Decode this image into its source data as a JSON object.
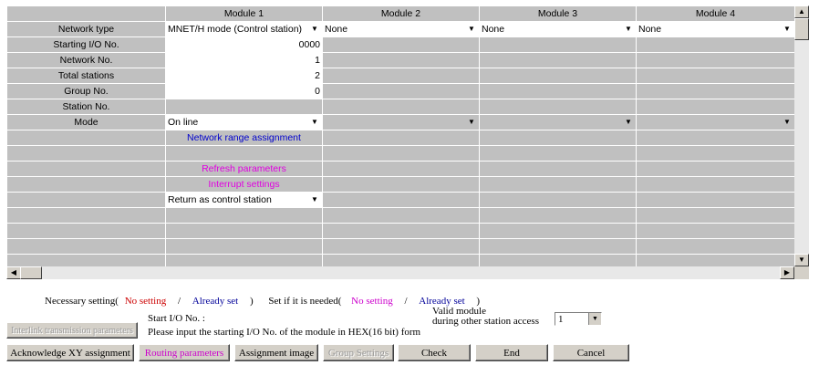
{
  "grid": {
    "columns": [
      "Module 1",
      "Module 2",
      "Module 3",
      "Module 4"
    ],
    "rows": [
      {
        "label": "Network type",
        "cells": [
          {
            "type": "select",
            "value": "MNET/H mode (Control station)"
          },
          {
            "type": "select",
            "value": "None"
          },
          {
            "type": "select",
            "value": "None"
          },
          {
            "type": "select",
            "value": "None"
          }
        ]
      },
      {
        "label": "Starting I/O No.",
        "cells": [
          {
            "type": "input",
            "value": "0000"
          },
          {
            "type": "blank"
          },
          {
            "type": "blank"
          },
          {
            "type": "blank"
          }
        ]
      },
      {
        "label": "Network No.",
        "cells": [
          {
            "type": "input",
            "value": "1"
          },
          {
            "type": "blank"
          },
          {
            "type": "blank"
          },
          {
            "type": "blank"
          }
        ]
      },
      {
        "label": "Total stations",
        "cells": [
          {
            "type": "input",
            "value": "2"
          },
          {
            "type": "blank"
          },
          {
            "type": "blank"
          },
          {
            "type": "blank"
          }
        ]
      },
      {
        "label": "Group No.",
        "cells": [
          {
            "type": "input",
            "value": "0"
          },
          {
            "type": "blank"
          },
          {
            "type": "blank"
          },
          {
            "type": "blank"
          }
        ]
      },
      {
        "label": "Station No.",
        "cells": [
          {
            "type": "blank"
          },
          {
            "type": "blank"
          },
          {
            "type": "blank"
          },
          {
            "type": "blank"
          }
        ]
      },
      {
        "label": "Mode",
        "cells": [
          {
            "type": "select",
            "value": "On line"
          },
          {
            "type": "select",
            "value": ""
          },
          {
            "type": "select",
            "value": ""
          },
          {
            "type": "select",
            "value": ""
          }
        ]
      },
      {
        "label": "",
        "cells": [
          {
            "type": "link",
            "value": "Network range assignment"
          },
          {
            "type": "blank"
          },
          {
            "type": "blank"
          },
          {
            "type": "blank"
          }
        ]
      },
      {
        "label": "",
        "cells": [
          {
            "type": "blank"
          },
          {
            "type": "blank"
          },
          {
            "type": "blank"
          },
          {
            "type": "blank"
          }
        ]
      },
      {
        "label": "",
        "cells": [
          {
            "type": "linkm",
            "value": "Refresh parameters"
          },
          {
            "type": "blank"
          },
          {
            "type": "blank"
          },
          {
            "type": "blank"
          }
        ]
      },
      {
        "label": "",
        "cells": [
          {
            "type": "linkm",
            "value": "Interrupt settings"
          },
          {
            "type": "blank"
          },
          {
            "type": "blank"
          },
          {
            "type": "blank"
          }
        ]
      },
      {
        "label": "",
        "cells": [
          {
            "type": "select",
            "value": "Return as control station"
          },
          {
            "type": "blank"
          },
          {
            "type": "blank"
          },
          {
            "type": "blank"
          }
        ]
      },
      {
        "label": "",
        "cells": [
          {
            "type": "blank"
          },
          {
            "type": "blank"
          },
          {
            "type": "blank"
          },
          {
            "type": "blank"
          }
        ]
      },
      {
        "label": "",
        "cells": [
          {
            "type": "blank"
          },
          {
            "type": "blank"
          },
          {
            "type": "blank"
          },
          {
            "type": "blank"
          }
        ]
      },
      {
        "label": "",
        "cells": [
          {
            "type": "blank"
          },
          {
            "type": "blank"
          },
          {
            "type": "blank"
          },
          {
            "type": "blank"
          }
        ]
      },
      {
        "label": "",
        "cells": [
          {
            "type": "blank"
          },
          {
            "type": "blank"
          },
          {
            "type": "blank"
          },
          {
            "type": "blank"
          }
        ]
      }
    ]
  },
  "scroll": {
    "up_icon": "up-arrow-icon",
    "down_icon": "down-arrow-icon",
    "left_icon": "left-arrow-icon",
    "right_icon": "right-arrow-icon"
  },
  "legend": {
    "necessary_prefix": "Necessary setting(",
    "no_setting": "No setting",
    "slash": "/",
    "already_set": "Already set",
    "close": ")",
    "if_needed_prefix": "Set if it is needed(",
    "no_setting2": "No setting",
    "already_set2": "Already set",
    "close2": ")"
  },
  "hint": {
    "start_io_label": "Start I/O No. :",
    "instruction": "Please input the starting I/O No. of the module in HEX(16 bit) form"
  },
  "valid_module": {
    "label_line1": "Valid module",
    "label_line2": "during other station access",
    "value": "1"
  },
  "buttons": {
    "interlink": "Interlink transmission parameters",
    "acknowledge": "Acknowledge XY assignment",
    "routing": "Routing parameters",
    "assignment_image": "Assignment image",
    "group_settings": "Group Settings",
    "check": "Check",
    "end": "End",
    "cancel": "Cancel"
  },
  "colors": {
    "grid_gray": "#c0c0c0",
    "necessary_red": "#cc0000",
    "already_blue": "#000099",
    "optional_magenta": "#cc00cc"
  }
}
